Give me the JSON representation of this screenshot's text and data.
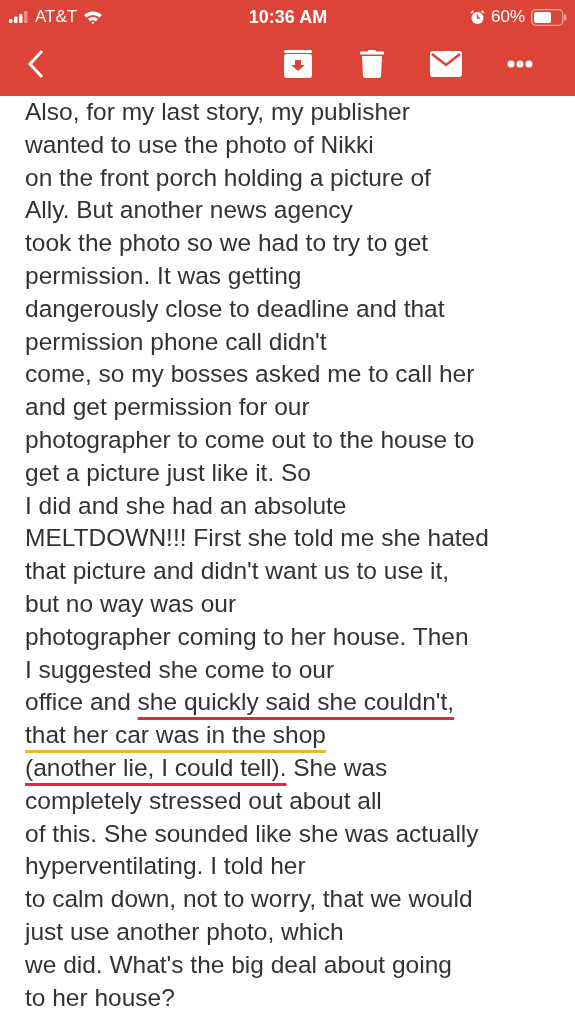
{
  "status_bar": {
    "carrier": "AT&T",
    "time": "10:36 AM",
    "battery": "60%"
  },
  "body": {
    "lines": [
      {
        "parts": [
          {
            "text": "Also, for my last story, my publisher"
          }
        ]
      },
      {
        "parts": [
          {
            "text": "wanted to use the photo of Nikki"
          }
        ]
      },
      {
        "parts": [
          {
            "text": "on the front porch holding a picture of"
          }
        ]
      },
      {
        "parts": [
          {
            "text": "Ally. But another news agency"
          }
        ]
      },
      {
        "parts": [
          {
            "text": "took the photo so we had to try to get"
          }
        ]
      },
      {
        "parts": [
          {
            "text": "permission. It was getting"
          }
        ]
      },
      {
        "parts": [
          {
            "text": "dangerously close to deadline and that"
          }
        ]
      },
      {
        "parts": [
          {
            "text": "permission phone call didn't"
          }
        ]
      },
      {
        "parts": [
          {
            "text": "come, so my bosses asked me to call her"
          }
        ]
      },
      {
        "parts": [
          {
            "text": "and get permission for our"
          }
        ]
      },
      {
        "parts": [
          {
            "text": "photographer to come out to the house to"
          }
        ]
      },
      {
        "parts": [
          {
            "text": "get a picture just like it. So"
          }
        ]
      },
      {
        "parts": [
          {
            "text": "I did and she had an absolute"
          }
        ]
      },
      {
        "parts": [
          {
            "text": "MELTDOWN!!! First she told me she hated"
          }
        ]
      },
      {
        "parts": [
          {
            "text": "that picture and didn't want us to use it,"
          }
        ]
      },
      {
        "parts": [
          {
            "text": "but no way was our"
          }
        ]
      },
      {
        "parts": [
          {
            "text": "photographer coming to her house. Then"
          }
        ]
      },
      {
        "parts": [
          {
            "text": "I suggested she come to our"
          }
        ]
      },
      {
        "parts": [
          {
            "text": "office and "
          },
          {
            "text": "she quickly said she couldn't,",
            "underlined": true,
            "color": "#e8263f"
          }
        ]
      },
      {
        "parts": [
          {
            "text": "that her car was in the shop",
            "underlined": true,
            "color": "#f2b233"
          }
        ]
      },
      {
        "parts": [
          {
            "text": "(another lie, I could tell).",
            "underlined": true,
            "color": "#e8263f"
          },
          {
            "text": " She was"
          }
        ]
      },
      {
        "parts": [
          {
            "text": "completely stressed out about all"
          }
        ]
      },
      {
        "parts": [
          {
            "text": "of this. She sounded like she was actually"
          }
        ]
      },
      {
        "parts": [
          {
            "text": "hyperventilating. I told her"
          }
        ]
      },
      {
        "parts": [
          {
            "text": "to calm down, not to worry, that we would"
          }
        ]
      },
      {
        "parts": [
          {
            "text": "just use another photo, which"
          }
        ]
      },
      {
        "parts": [
          {
            "text": "we did. What's the big deal about going"
          }
        ]
      },
      {
        "parts": [
          {
            "text": "to her house?"
          }
        ]
      }
    ]
  }
}
